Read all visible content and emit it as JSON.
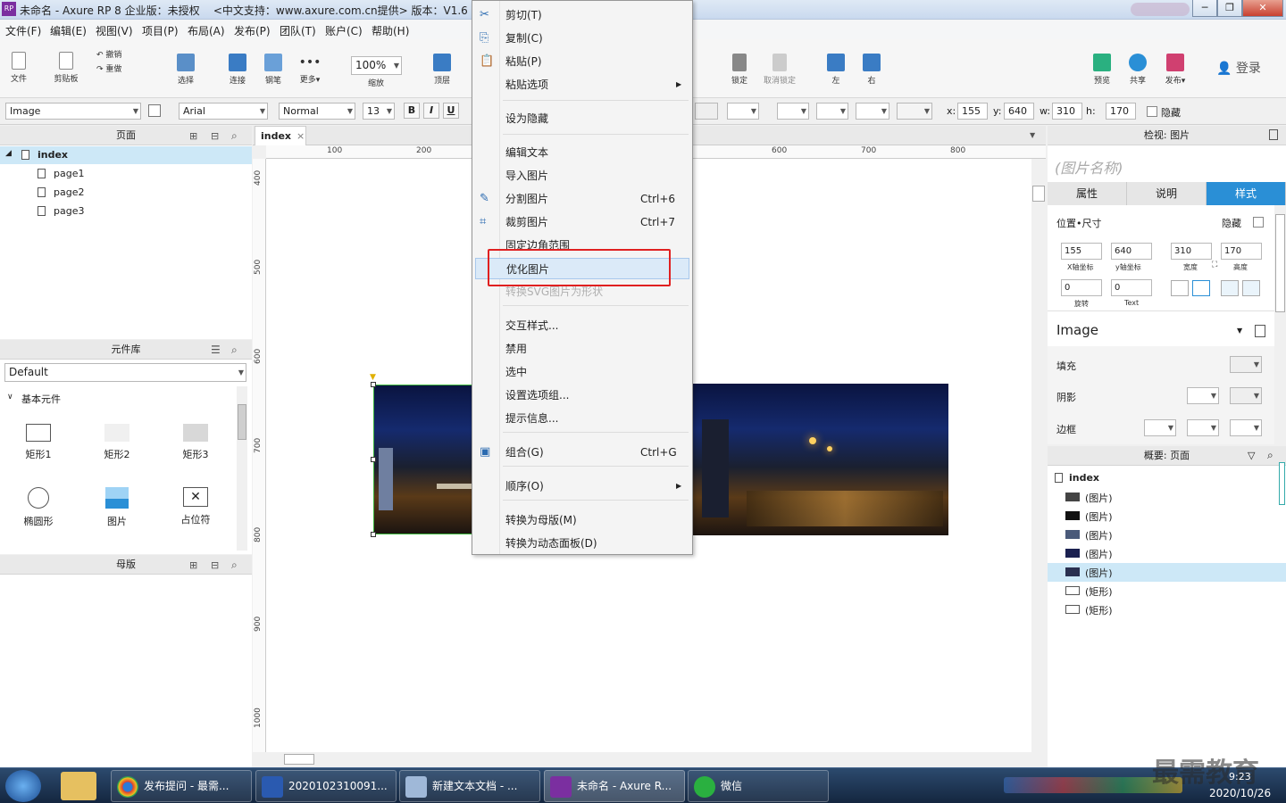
{
  "window": {
    "title": "未命名 - Axure RP 8 企业版：未授权",
    "subtitle": "<中文支持：www.axure.com.cn提供> 版本：V1.6",
    "app_badge": "RP"
  },
  "menubar": [
    "文件(F)",
    "编辑(E)",
    "视图(V)",
    "项目(P)",
    "布局(A)",
    "发布(P)",
    "团队(T)",
    "账户(C)",
    "帮助(H)"
  ],
  "toolbar": {
    "file": "文件",
    "clipboard": "剪贴板",
    "undo": "撤销",
    "redo": "重做",
    "select": "选择",
    "connect": "连接",
    "pen": "钢笔",
    "more": "更多▾",
    "zoom_value": "100%",
    "zoom_label": "缩放",
    "top": "顶层",
    "lock": "锁定",
    "unlock": "取消锁定",
    "left": "左",
    "right": "右",
    "preview": "预览",
    "share": "共享",
    "publish": "发布▾",
    "login": "登录"
  },
  "format": {
    "widget_type": "Image",
    "font": "Arial",
    "weight": "Normal",
    "size": "13",
    "bold": "B",
    "italic": "I",
    "underline": "U",
    "x_label": "x:",
    "x": "155",
    "y_label": "y:",
    "y": "640",
    "w_label": "w:",
    "w": "310",
    "h_label": "h:",
    "h": "170",
    "hidden": "隐藏"
  },
  "pages_panel": {
    "title": "页面",
    "root": "index",
    "pages": [
      "page1",
      "page2",
      "page3"
    ]
  },
  "library_panel": {
    "title": "元件库",
    "selected": "Default",
    "group": "基本元件",
    "widgets": [
      "矩形1",
      "矩形2",
      "矩形3",
      "椭圆形",
      "图片",
      "占位符"
    ]
  },
  "masters_panel": {
    "title": "母版"
  },
  "canvas": {
    "tab": "index",
    "ruler_h": [
      "100",
      "200",
      "600",
      "700",
      "800"
    ],
    "ruler_v": [
      "400",
      "500",
      "600",
      "700",
      "800",
      "900",
      "1000"
    ]
  },
  "context_menu": [
    {
      "label": "剪切(T)",
      "shortcut": "",
      "icon": "scissors-icon"
    },
    {
      "label": "复制(C)",
      "shortcut": "",
      "icon": "copy-icon"
    },
    {
      "label": "粘贴(P)",
      "shortcut": "",
      "icon": "paste-icon"
    },
    {
      "label": "粘贴选项",
      "shortcut": "",
      "submenu": true
    },
    {
      "label": "设为隐藏",
      "shortcut": ""
    },
    {
      "label": "编辑文本",
      "shortcut": ""
    },
    {
      "label": "导入图片",
      "shortcut": ""
    },
    {
      "label": "分割图片",
      "shortcut": "Ctrl+6",
      "icon": "split-icon"
    },
    {
      "label": "裁剪图片",
      "shortcut": "Ctrl+7",
      "icon": "crop-icon"
    },
    {
      "label": "固定边角范围",
      "shortcut": ""
    },
    {
      "label": "优化图片",
      "shortcut": "",
      "highlighted": true
    },
    {
      "label": "转换SVG图片为形状",
      "shortcut": "",
      "disabled": true
    },
    {
      "label": "交互样式...",
      "shortcut": ""
    },
    {
      "label": "禁用",
      "shortcut": ""
    },
    {
      "label": "选中",
      "shortcut": ""
    },
    {
      "label": "设置选项组...",
      "shortcut": ""
    },
    {
      "label": "提示信息...",
      "shortcut": ""
    },
    {
      "label": "组合(G)",
      "shortcut": "Ctrl+G",
      "icon": "group-icon"
    },
    {
      "label": "顺序(O)",
      "shortcut": "",
      "submenu": true
    },
    {
      "label": "转换为母版(M)",
      "shortcut": ""
    },
    {
      "label": "转换为动态面板(D)",
      "shortcut": ""
    }
  ],
  "inspector": {
    "title": "检视: 图片",
    "name_placeholder": "(图片名称)",
    "tabs": [
      "属性",
      "说明",
      "样式"
    ],
    "pos_size": "位置•尺寸",
    "hidden": "隐藏",
    "x": "155",
    "y": "640",
    "w": "310",
    "h": "170",
    "x_cap": "X轴坐标",
    "y_cap": "y轴坐标",
    "w_cap": "宽度",
    "h_cap": "高度",
    "rotate": "0",
    "text_rotate": "0",
    "rotate_cap": "旋转",
    "text_cap": "Text",
    "style_name": "Image",
    "fill": "填充",
    "shadow": "阴影",
    "border": "边框"
  },
  "outline": {
    "title": "概要: 页面",
    "root": "index",
    "items": [
      "(图片)",
      "(图片)",
      "(图片)",
      "(图片)",
      "(图片)",
      "(矩形)",
      "(矩形)"
    ]
  },
  "taskbar": {
    "tasks": [
      "发布提问 - 最需...",
      "2020102310091...",
      "新建文本文档 - ...",
      "未命名 - Axure R...",
      "微信"
    ],
    "time": "9:23",
    "date": "2020/10/26",
    "watermark": "最需教育"
  },
  "colors": {
    "accent": "#2a8fd6",
    "highlight_box": "#e02020",
    "selected_row": "#cde8f7"
  }
}
